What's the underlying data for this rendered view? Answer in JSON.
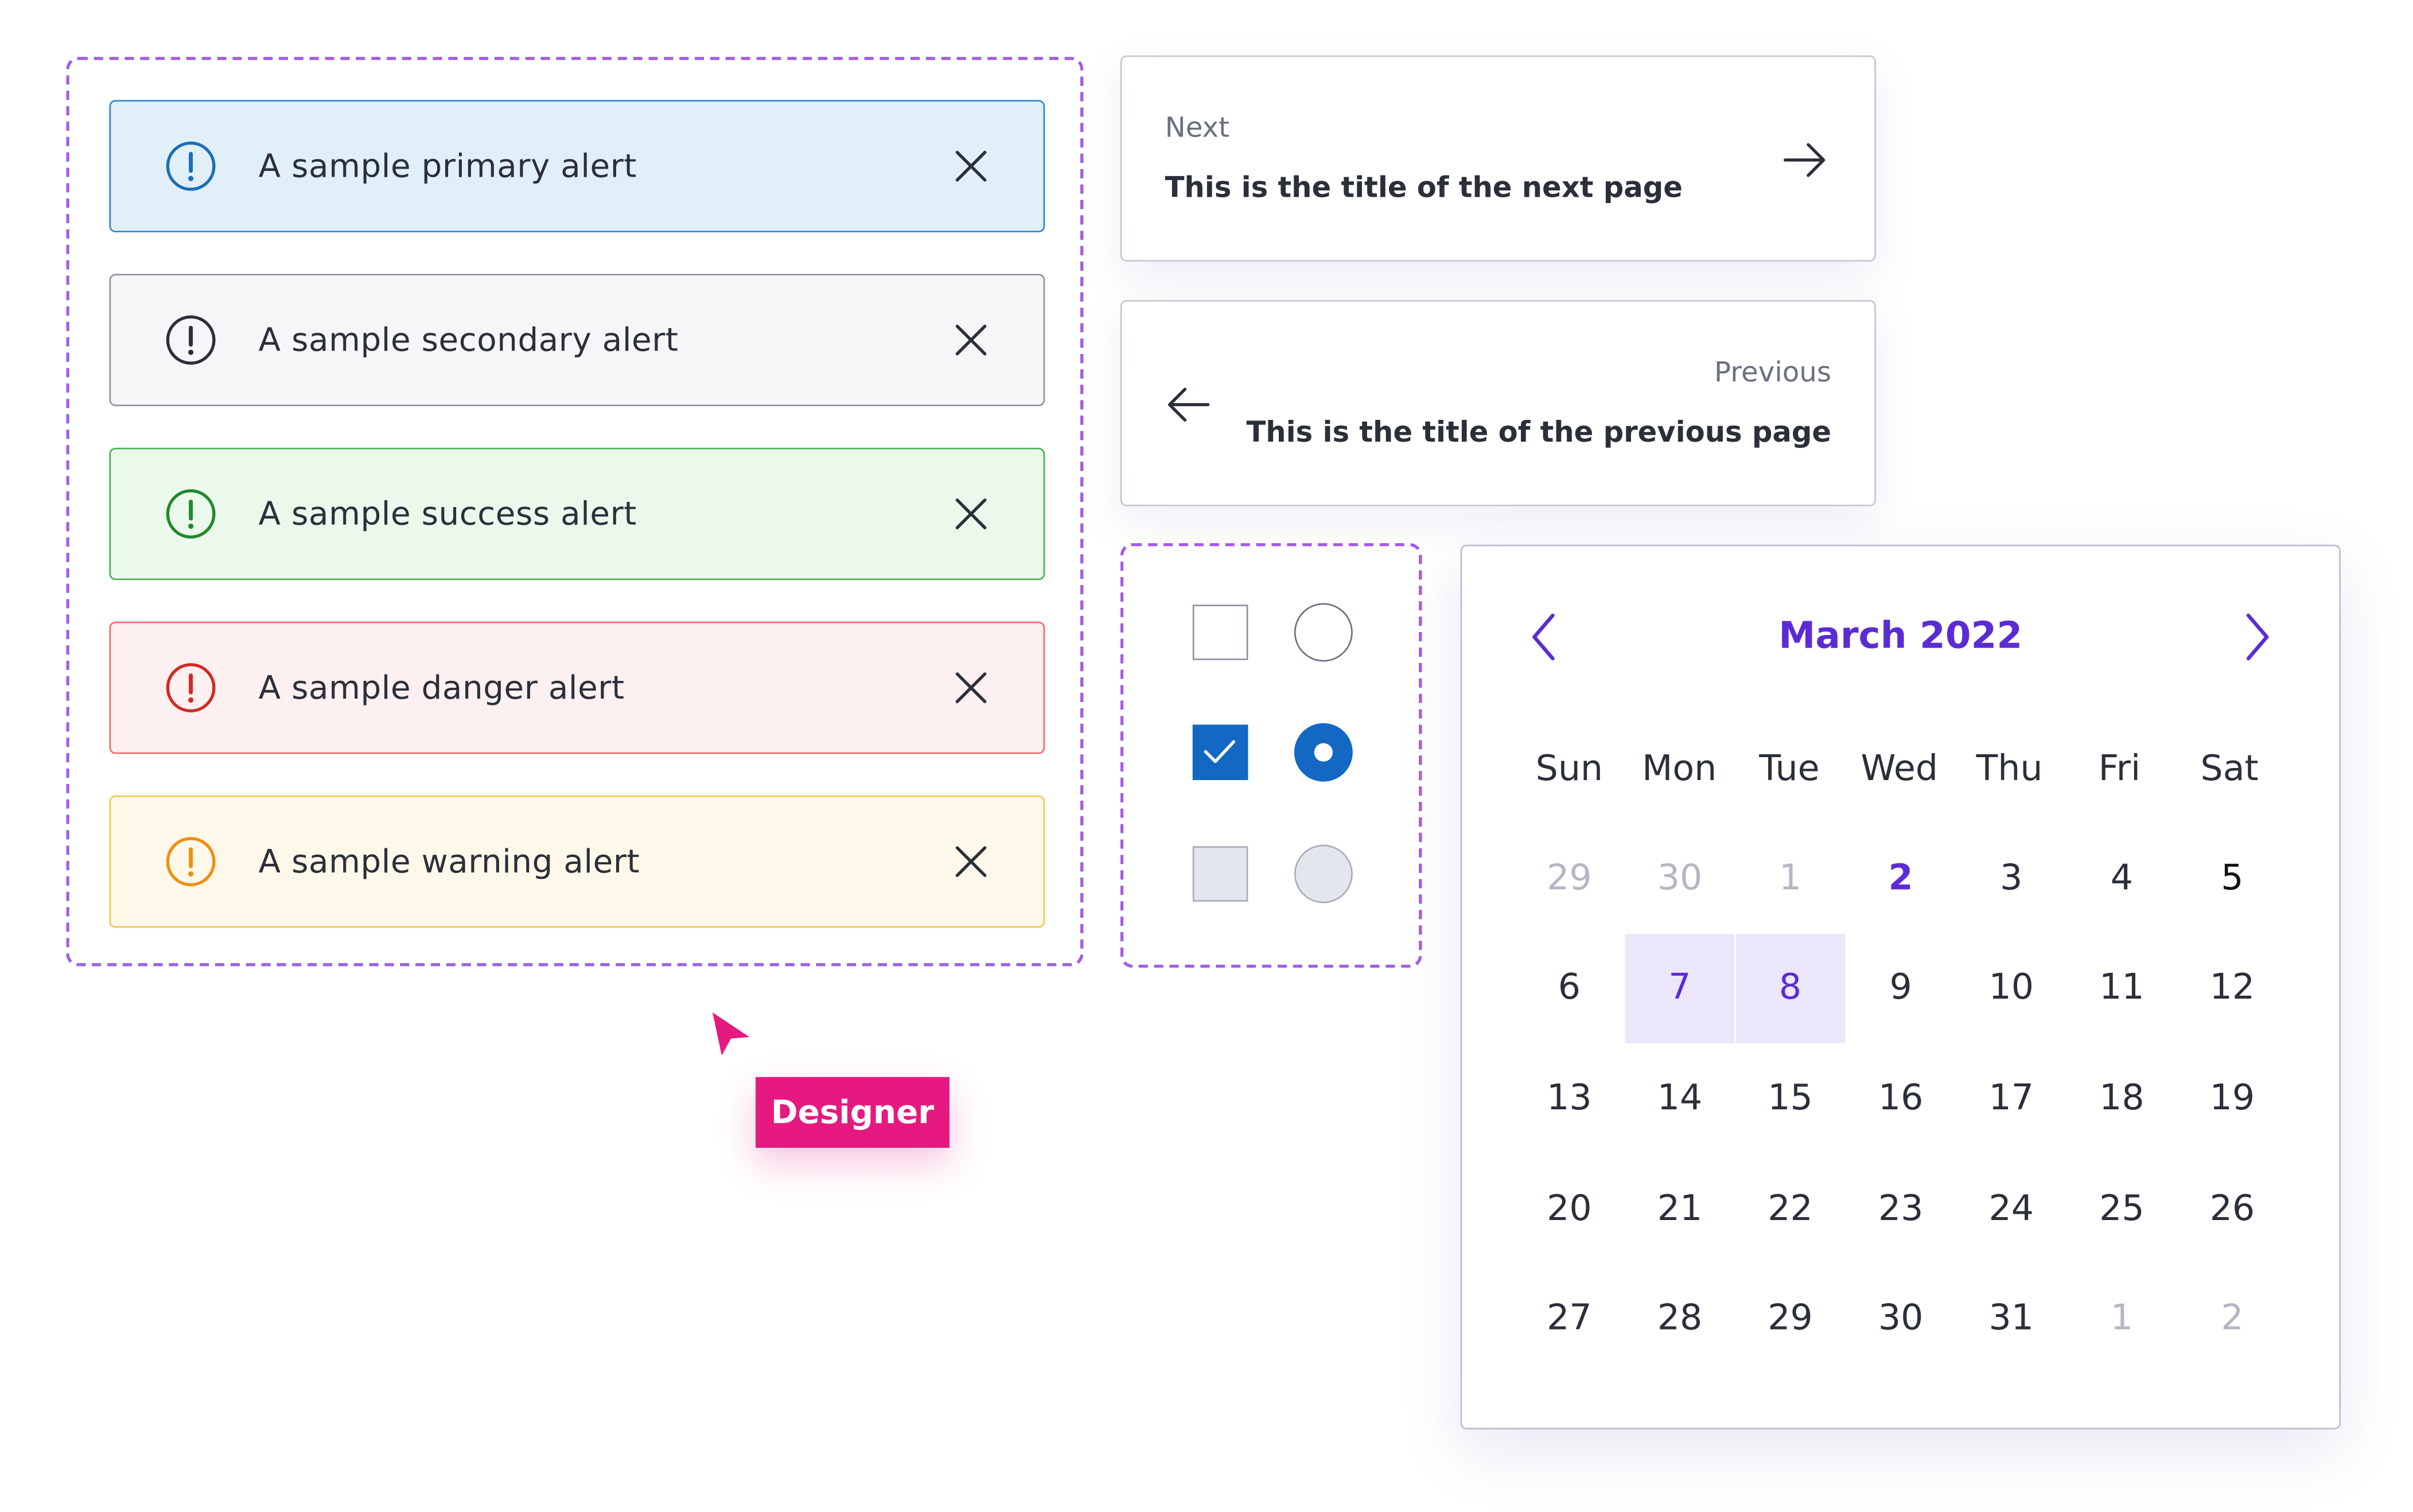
{
  "alerts": [
    {
      "kind": "primary",
      "text": "A sample primary alert",
      "bg": "#e1eff9",
      "border": "#2f86c9",
      "icon_color": "#1a6fb8",
      "icon": "exclamation-circle-icon"
    },
    {
      "kind": "secondary",
      "text": "A sample secondary alert",
      "bg": "#f6f6f9",
      "border": "#8e92a0",
      "icon_color": "#2b2f3a",
      "icon": "exclamation-circle-icon"
    },
    {
      "kind": "success",
      "text": "A sample success alert",
      "bg": "#ebf8ec",
      "border": "#45b14f",
      "icon_color": "#1f8a2b",
      "icon": "exclamation-circle-icon"
    },
    {
      "kind": "danger",
      "text": "A sample danger alert",
      "bg": "#fdf0f0",
      "border": "#ef6b66",
      "icon_color": "#d12a22",
      "icon": "exclamation-circle-icon"
    },
    {
      "kind": "warning",
      "text": "A sample warning alert",
      "bg": "#fef8ea",
      "border": "#f2c94c",
      "icon_color": "#ef8f12",
      "icon": "exclamation-circle-icon"
    }
  ],
  "pagination": {
    "next": {
      "label": "Next",
      "title": "This is the title of the next page",
      "icon": "arrow-right-icon"
    },
    "previous": {
      "label": "Previous",
      "title": "This is the title of the previous page",
      "icon": "arrow-left-icon"
    }
  },
  "controls": {
    "checkbox_states": [
      "unchecked",
      "checked",
      "disabled"
    ],
    "radio_states": [
      "unselected",
      "selected",
      "disabled"
    ],
    "accent": "#1368c4"
  },
  "calendar": {
    "month": "March 2022",
    "weekdays": [
      "Sun",
      "Mon",
      "Tue",
      "Wed",
      "Thu",
      "Fri",
      "Sat"
    ],
    "weeks": [
      [
        "29",
        "30",
        "1",
        "2",
        "3",
        "4",
        "5"
      ],
      [
        "6",
        "7",
        "8",
        "9",
        "10",
        "11",
        "12"
      ],
      [
        "13",
        "14",
        "15",
        "16",
        "17",
        "18",
        "19"
      ],
      [
        "20",
        "21",
        "22",
        "23",
        "24",
        "25",
        "26"
      ],
      [
        "27",
        "28",
        "29",
        "30",
        "31",
        "1",
        "2"
      ]
    ],
    "muted_days": [
      [
        0,
        0
      ],
      [
        0,
        1
      ],
      [
        0,
        2
      ],
      [
        4,
        5
      ],
      [
        4,
        6
      ]
    ],
    "today": [
      0,
      3
    ],
    "selected_range": [
      [
        1,
        1
      ],
      [
        1,
        2
      ]
    ],
    "accent": "#5b2bd6"
  },
  "cursor": {
    "label": "Designer",
    "color": "#e5197f"
  }
}
